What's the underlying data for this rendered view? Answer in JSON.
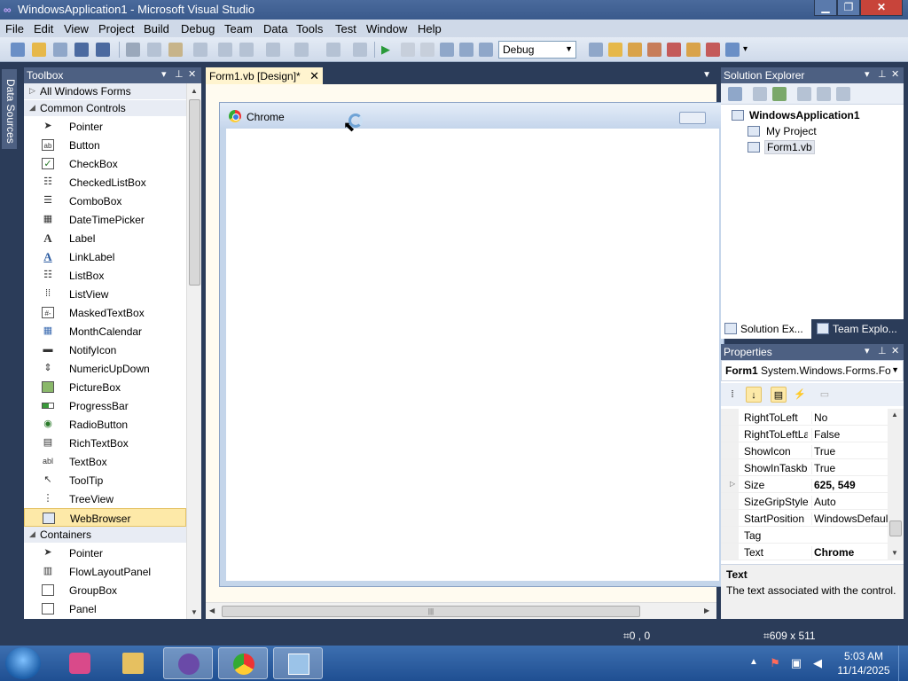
{
  "window": {
    "title": "WindowsApplication1 - Microsoft Visual Studio",
    "app_icon": "visual-studio-icon"
  },
  "menu": [
    "File",
    "Edit",
    "View",
    "Project",
    "Build",
    "Debug",
    "Team",
    "Data",
    "Tools",
    "Test",
    "Window",
    "Help"
  ],
  "toolbar": {
    "configuration": "Debug"
  },
  "data_sources_tab": "Data Sources",
  "toolbox": {
    "title": "Toolbox",
    "categories": {
      "all": "All Windows Forms",
      "common": "Common Controls",
      "containers": "Containers"
    },
    "common_items": [
      {
        "label": "Pointer",
        "icon": "pointer-icon"
      },
      {
        "label": "Button",
        "icon": "button-icon"
      },
      {
        "label": "CheckBox",
        "icon": "checkbox-icon"
      },
      {
        "label": "CheckedListBox",
        "icon": "checkedlistbox-icon"
      },
      {
        "label": "ComboBox",
        "icon": "combobox-icon"
      },
      {
        "label": "DateTimePicker",
        "icon": "datetimepicker-icon"
      },
      {
        "label": "Label",
        "icon": "label-icon"
      },
      {
        "label": "LinkLabel",
        "icon": "linklabel-icon"
      },
      {
        "label": "ListBox",
        "icon": "listbox-icon"
      },
      {
        "label": "ListView",
        "icon": "listview-icon"
      },
      {
        "label": "MaskedTextBox",
        "icon": "maskedtextbox-icon"
      },
      {
        "label": "MonthCalendar",
        "icon": "monthcalendar-icon"
      },
      {
        "label": "NotifyIcon",
        "icon": "notifyicon-icon"
      },
      {
        "label": "NumericUpDown",
        "icon": "numericupdown-icon"
      },
      {
        "label": "PictureBox",
        "icon": "picturebox-icon"
      },
      {
        "label": "ProgressBar",
        "icon": "progressbar-icon"
      },
      {
        "label": "RadioButton",
        "icon": "radiobutton-icon"
      },
      {
        "label": "RichTextBox",
        "icon": "richtextbox-icon"
      },
      {
        "label": "TextBox",
        "icon": "textbox-icon"
      },
      {
        "label": "ToolTip",
        "icon": "tooltip-icon"
      },
      {
        "label": "TreeView",
        "icon": "treeview-icon"
      },
      {
        "label": "WebBrowser",
        "icon": "webbrowser-icon"
      }
    ],
    "selected_item": "WebBrowser",
    "container_items": [
      {
        "label": "Pointer",
        "icon": "pointer-icon"
      },
      {
        "label": "FlowLayoutPanel",
        "icon": "flowlayoutpanel-icon"
      },
      {
        "label": "GroupBox",
        "icon": "groupbox-icon"
      },
      {
        "label": "Panel",
        "icon": "panel-icon"
      }
    ]
  },
  "designer": {
    "tab_label": "Form1.vb [Design]*",
    "form_title": "Chrome"
  },
  "solution_explorer": {
    "title": "Solution Explorer",
    "solution": "WindowsApplication1",
    "items": [
      "My Project",
      "Form1.vb"
    ],
    "selected": "Form1.vb",
    "tabs": [
      "Solution Ex...",
      "Team Explo..."
    ]
  },
  "properties": {
    "title": "Properties",
    "object_name": "Form1",
    "object_type": "System.Windows.Forms.Fo",
    "rows": [
      {
        "name": "RightToLeft",
        "value": "No"
      },
      {
        "name": "RightToLeftLa",
        "value": "False"
      },
      {
        "name": "ShowIcon",
        "value": "True"
      },
      {
        "name": "ShowInTaskb",
        "value": "True"
      },
      {
        "name": "Size",
        "value": "625, 549"
      },
      {
        "name": "SizeGripStyle",
        "value": "Auto"
      },
      {
        "name": "StartPosition",
        "value": "WindowsDefault"
      },
      {
        "name": "Tag",
        "value": ""
      },
      {
        "name": "Text",
        "value": "Chrome"
      }
    ],
    "desc_title": "Text",
    "desc_text": "The text associated with the control."
  },
  "status": {
    "position": "0 , 0",
    "size": "609 x 511"
  },
  "taskbar": {
    "time": "5:03 AM",
    "date": "11/14/2025"
  },
  "colors": {
    "panel_header": "#4d6082",
    "ide_bg": "#2b3c59",
    "selection": "#fde9a8"
  }
}
